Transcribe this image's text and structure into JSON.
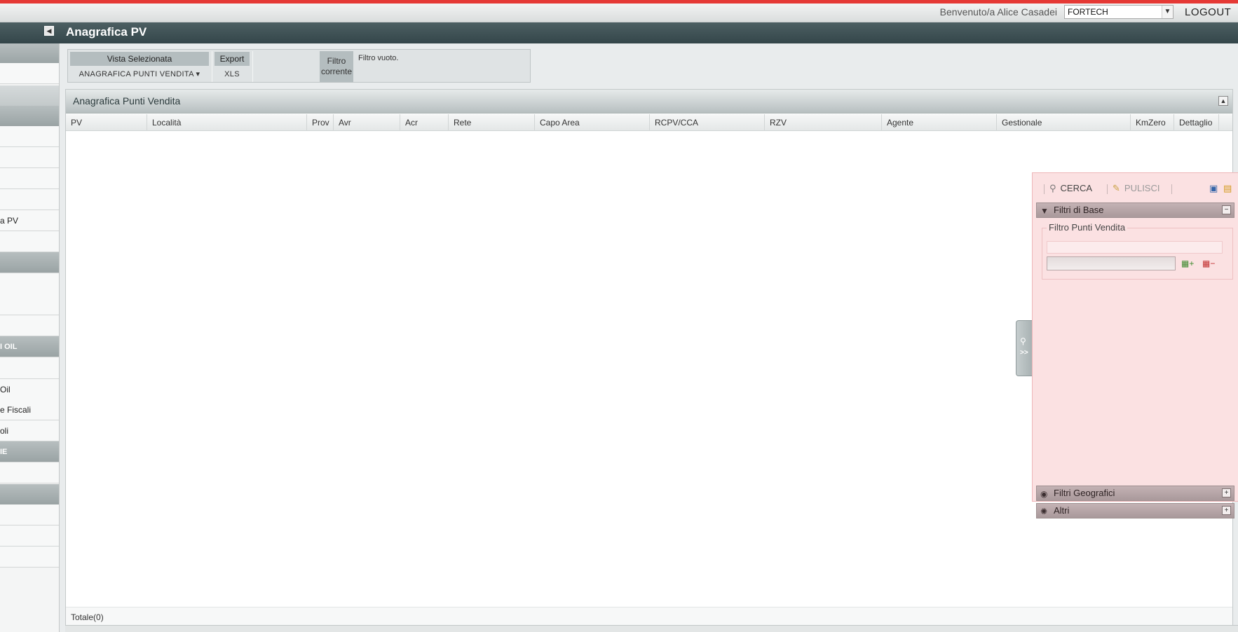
{
  "header": {
    "welcome": "Benvenuto/a Alice Casadei",
    "company": "FORTECH",
    "logout": "LOGOUT"
  },
  "title": "Anagrafica PV",
  "sidebar": {
    "items": [
      {
        "label": "",
        "type": "section"
      },
      {
        "label": "",
        "type": "row"
      },
      {
        "label": "",
        "type": "light"
      },
      {
        "label": "",
        "type": "section"
      },
      {
        "label": "",
        "type": "row"
      },
      {
        "label": "",
        "type": "row"
      },
      {
        "label": "",
        "type": "row"
      },
      {
        "label": "",
        "type": "row"
      },
      {
        "label": "a PV",
        "type": "row"
      },
      {
        "label": "",
        "type": "row"
      },
      {
        "label": "",
        "type": "section"
      },
      {
        "label": "",
        "type": "row"
      },
      {
        "label": "",
        "type": "row"
      },
      {
        "label": "",
        "type": "row"
      },
      {
        "label": "I OIL",
        "type": "section"
      },
      {
        "label": "",
        "type": "row"
      },
      {
        "label": "Oil",
        "type": "row"
      },
      {
        "label": "e Fiscali",
        "type": "row"
      },
      {
        "label": "oli",
        "type": "row"
      },
      {
        "label": "IE",
        "type": "section"
      },
      {
        "label": "",
        "type": "row"
      },
      {
        "label": "",
        "type": "section"
      },
      {
        "label": "",
        "type": "row"
      },
      {
        "label": "",
        "type": "row"
      },
      {
        "label": "",
        "type": "row"
      }
    ]
  },
  "toolbar": {
    "vista_label": "Vista Selezionata",
    "vista_value": "ANAGRAFICA PUNTI VENDITA",
    "export_label": "Export",
    "export_value": "XLS",
    "filtro_label_1": "Filtro",
    "filtro_label_2": "corrente",
    "filtro_value": "Filtro vuoto."
  },
  "grid": {
    "title": "Anagrafica Punti Vendita",
    "columns": [
      "PV",
      "Località",
      "Prov",
      "Avr",
      "Acr",
      "Rete",
      "Capo Area",
      "RCPV/CCA",
      "RZV",
      "Agente",
      "Gestionale",
      "KmZero",
      "Dettaglio"
    ],
    "rows": [],
    "total": "Totale(0)"
  },
  "filter_panel": {
    "search": "CERCA",
    "clear": "PULISCI",
    "sections": {
      "base": "Filtri di Base",
      "geo": "Filtri Geografici",
      "altri": "Altri"
    },
    "fieldset_legend": "Filtro Punti Vendita",
    "input_value": "",
    "handle_label": ">>"
  },
  "colors": {
    "title_bar": "#3f5255",
    "filter_bg": "#fbe1e2",
    "alert_strip": "#e53935"
  }
}
